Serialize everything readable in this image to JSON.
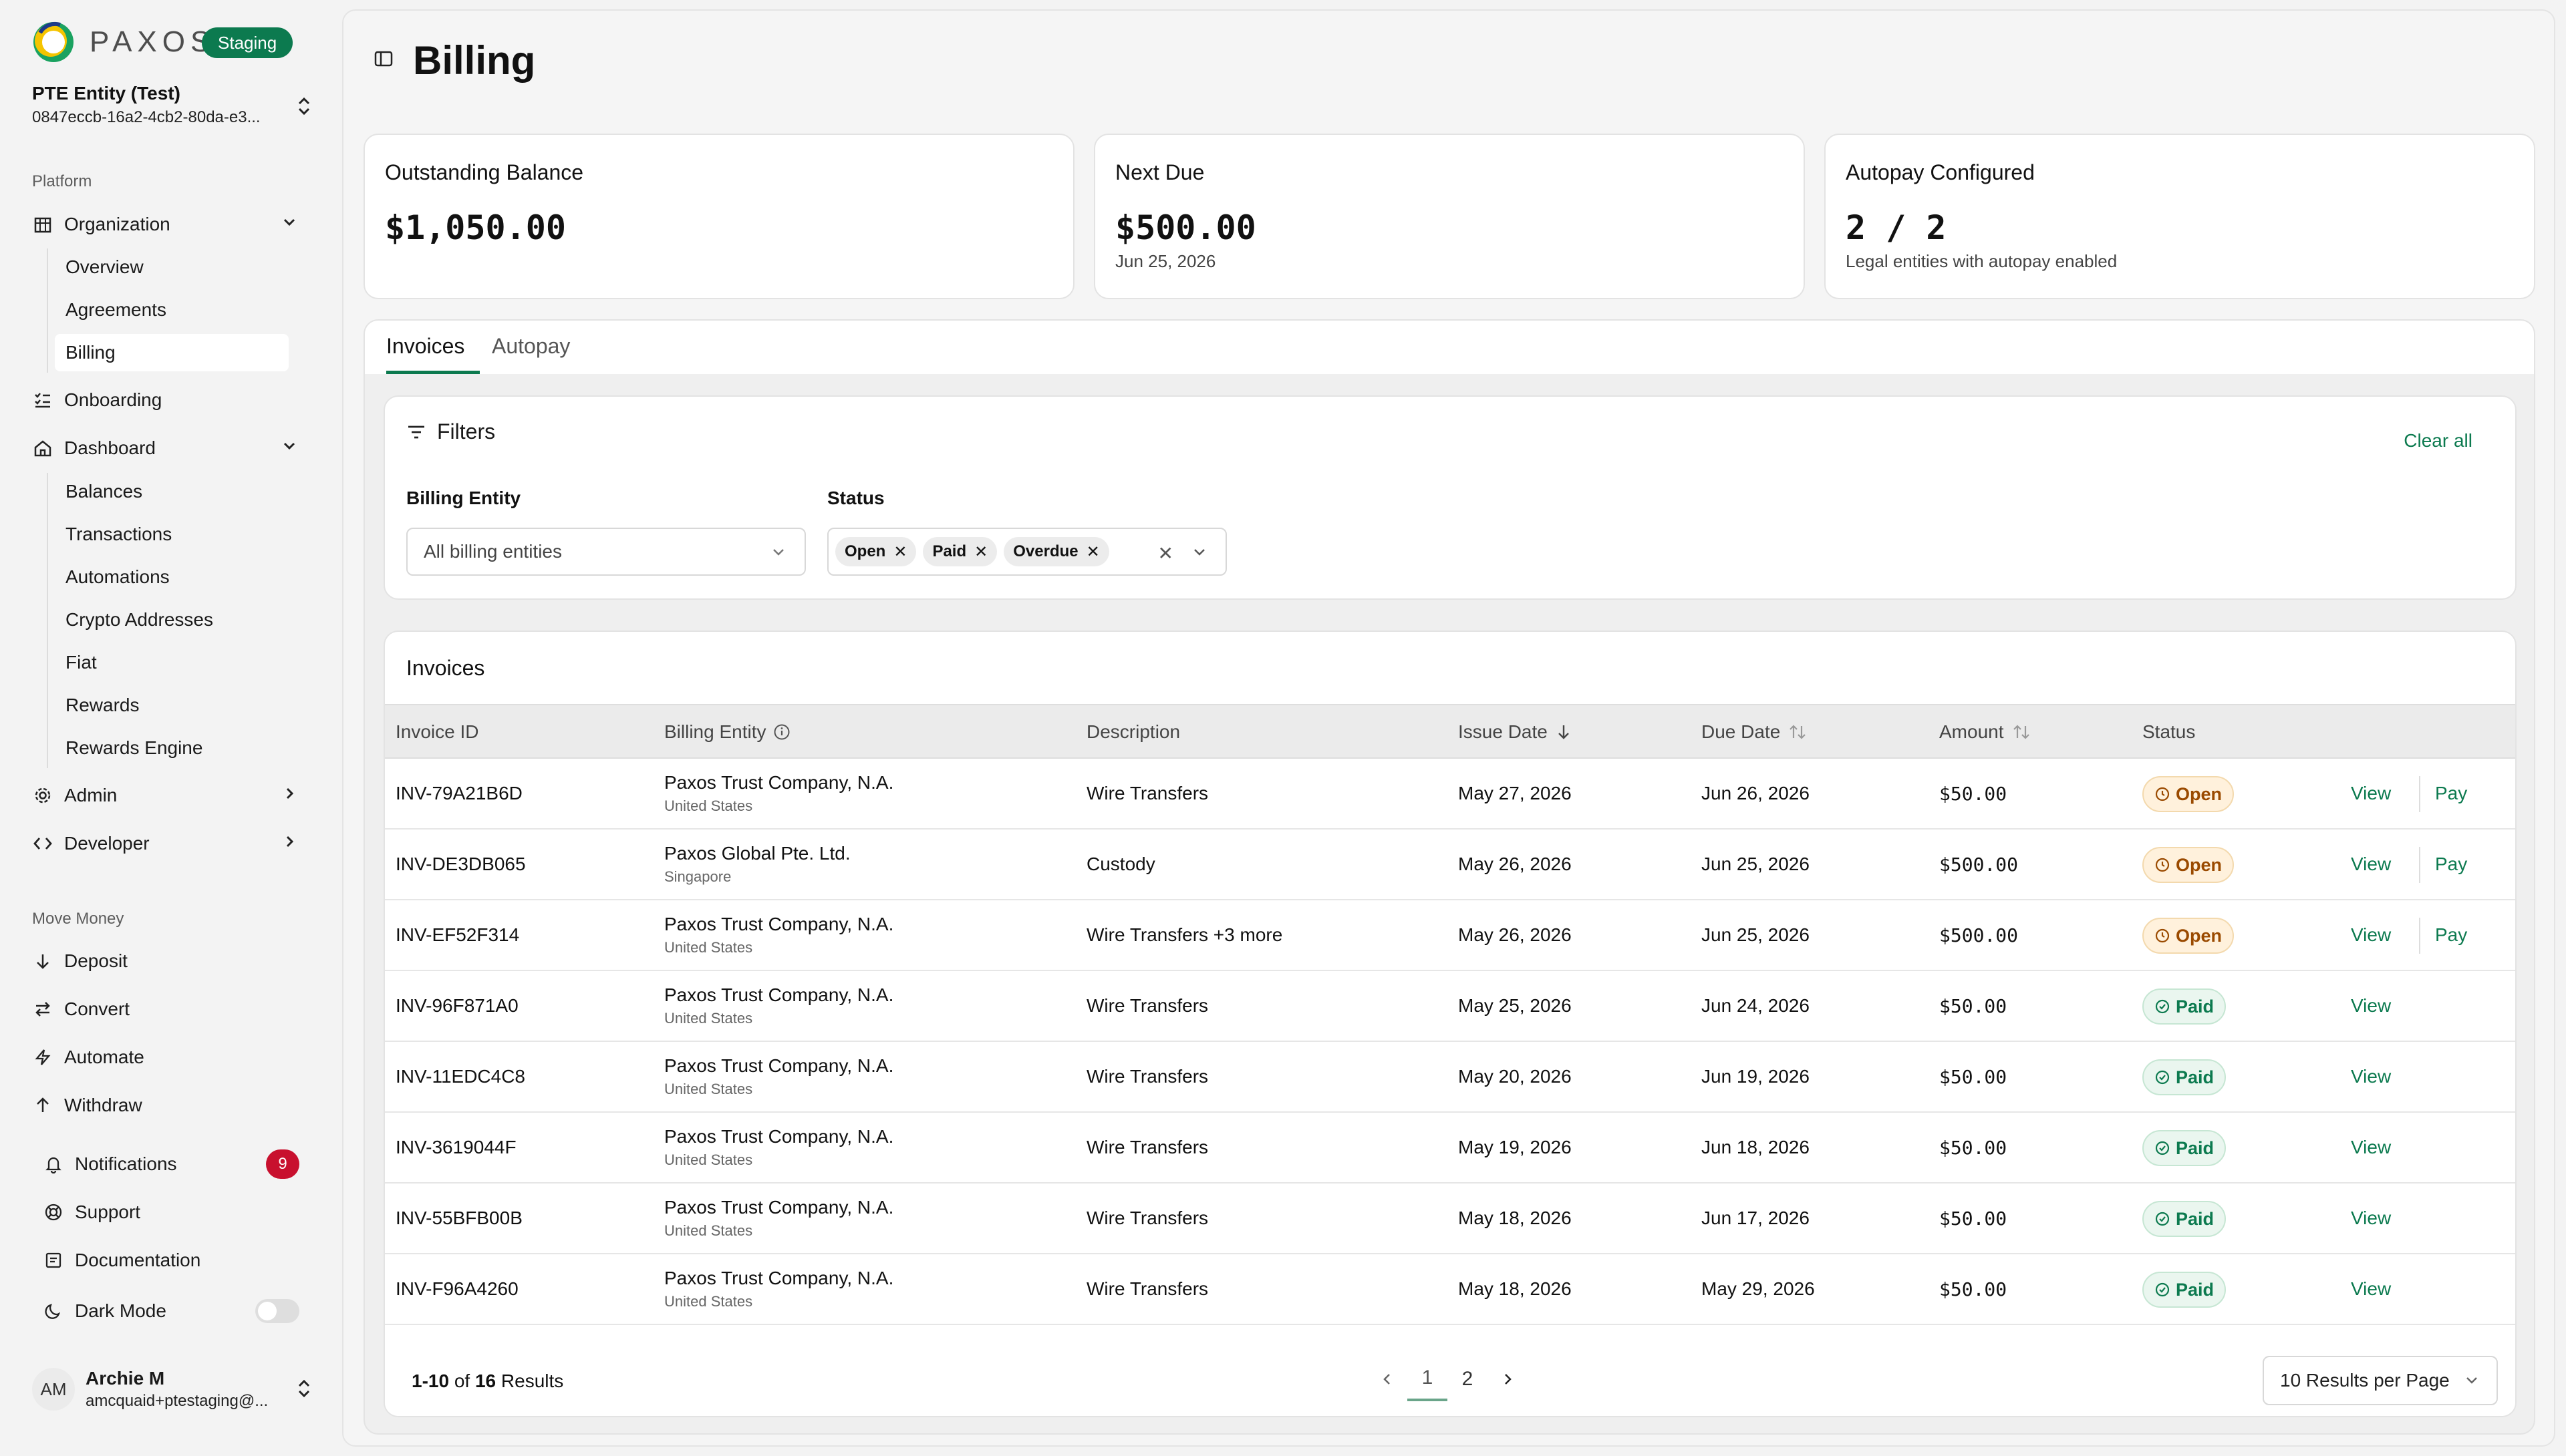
{
  "brand": {
    "name": "PAXOS",
    "env_badge": "Staging"
  },
  "entity": {
    "name": "PTE Entity (Test)",
    "id": "0847eccb-16a2-4cb2-80da-e3..."
  },
  "sidebar": {
    "platform_label": "Platform",
    "organization": {
      "label": "Organization",
      "items": [
        "Overview",
        "Agreements",
        "Billing"
      ],
      "active": "Billing"
    },
    "onboarding_label": "Onboarding",
    "dashboard": {
      "label": "Dashboard",
      "items": [
        "Balances",
        "Transactions",
        "Automations",
        "Crypto Addresses",
        "Fiat",
        "Rewards",
        "Rewards Engine"
      ]
    },
    "admin_label": "Admin",
    "developer_label": "Developer",
    "move_money_label": "Move Money",
    "move_money": [
      "Deposit",
      "Convert",
      "Automate",
      "Withdraw"
    ],
    "notifications_label": "Notifications",
    "notifications_count": "9",
    "support_label": "Support",
    "documentation_label": "Documentation",
    "dark_mode_label": "Dark Mode",
    "dark_mode_on": false
  },
  "user": {
    "initials": "AM",
    "name": "Archie M",
    "email": "amcquaid+ptestaging@..."
  },
  "page": {
    "title": "Billing"
  },
  "stats": [
    {
      "title": "Outstanding Balance",
      "value": "$1,050.00",
      "sub": ""
    },
    {
      "title": "Next Due",
      "value": "$500.00",
      "sub": "Jun 25, 2026"
    },
    {
      "title": "Autopay Configured",
      "value": "2 / 2",
      "sub": "Legal entities with autopay enabled"
    }
  ],
  "tabs": {
    "invoices": "Invoices",
    "autopay": "Autopay",
    "active": "Invoices"
  },
  "filters": {
    "title": "Filters",
    "clear_all": "Clear all",
    "billing_entity_label": "Billing Entity",
    "billing_entity_value": "All billing entities",
    "status_label": "Status",
    "status_chips": [
      "Open",
      "Paid",
      "Overdue"
    ]
  },
  "invoices": {
    "title": "Invoices",
    "columns": [
      "Invoice ID",
      "Billing Entity",
      "Description",
      "Issue Date",
      "Due Date",
      "Amount",
      "Status"
    ],
    "rows": [
      {
        "id": "INV-79A21B6D",
        "entity": "Paxos Trust Company, N.A.",
        "country": "United States",
        "desc": "Wire Transfers",
        "issue": "May 27, 2026",
        "due": "Jun 26, 2026",
        "amount": "$50.00",
        "status": "Open",
        "view": "View",
        "pay": "Pay"
      },
      {
        "id": "INV-DE3DB065",
        "entity": "Paxos Global Pte. Ltd.",
        "country": "Singapore",
        "desc": "Custody",
        "issue": "May 26, 2026",
        "due": "Jun 25, 2026",
        "amount": "$500.00",
        "status": "Open",
        "view": "View",
        "pay": "Pay"
      },
      {
        "id": "INV-EF52F314",
        "entity": "Paxos Trust Company, N.A.",
        "country": "United States",
        "desc": "Wire Transfers +3 more",
        "issue": "May 26, 2026",
        "due": "Jun 25, 2026",
        "amount": "$500.00",
        "status": "Open",
        "view": "View",
        "pay": "Pay"
      },
      {
        "id": "INV-96F871A0",
        "entity": "Paxos Trust Company, N.A.",
        "country": "United States",
        "desc": "Wire Transfers",
        "issue": "May 25, 2026",
        "due": "Jun 24, 2026",
        "amount": "$50.00",
        "status": "Paid",
        "view": "View",
        "pay": ""
      },
      {
        "id": "INV-11EDC4C8",
        "entity": "Paxos Trust Company, N.A.",
        "country": "United States",
        "desc": "Wire Transfers",
        "issue": "May 20, 2026",
        "due": "Jun 19, 2026",
        "amount": "$50.00",
        "status": "Paid",
        "view": "View",
        "pay": ""
      },
      {
        "id": "INV-3619044F",
        "entity": "Paxos Trust Company, N.A.",
        "country": "United States",
        "desc": "Wire Transfers",
        "issue": "May 19, 2026",
        "due": "Jun 18, 2026",
        "amount": "$50.00",
        "status": "Paid",
        "view": "View",
        "pay": ""
      },
      {
        "id": "INV-55BFB00B",
        "entity": "Paxos Trust Company, N.A.",
        "country": "United States",
        "desc": "Wire Transfers",
        "issue": "May 18, 2026",
        "due": "Jun 17, 2026",
        "amount": "$50.00",
        "status": "Paid",
        "view": "View",
        "pay": ""
      },
      {
        "id": "INV-F96A4260",
        "entity": "Paxos Trust Company, N.A.",
        "country": "United States",
        "desc": "Wire Transfers",
        "issue": "May 18, 2026",
        "due": "May 29, 2026",
        "amount": "$50.00",
        "status": "Paid",
        "view": "View",
        "pay": ""
      }
    ]
  },
  "pagination": {
    "range": "1-10",
    "of": "of",
    "total": "16",
    "results_word": "Results",
    "pages": [
      "1",
      "2"
    ],
    "current_page": "1",
    "per_page": "10 Results per Page"
  },
  "colors": {
    "accent": "#0c7a4f",
    "open_text": "#9a4a00",
    "badge_red": "#c8102e"
  }
}
